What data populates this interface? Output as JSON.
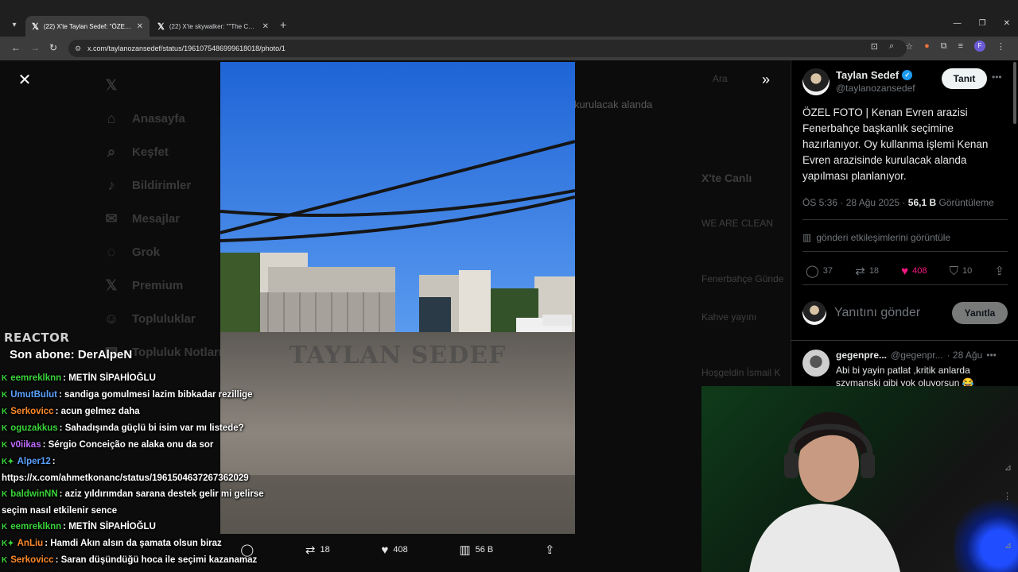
{
  "browser": {
    "tabs": [
      {
        "title": "(22) X'te Taylan Sedef: \"ÖZEL FO",
        "active": true
      },
      {
        "title": "(22) X'te skywalker: \"\"The Chos",
        "active": false
      }
    ],
    "new_tab": "+",
    "url": "x.com/taylanozansedef/status/1961075486999618018/photo/1"
  },
  "background": {
    "nav": [
      "Anasayfa",
      "Keşfet",
      "Bildirimler",
      "Mesajlar",
      "Grok",
      "Premium",
      "Topluluklar",
      "Topluluk Notları"
    ],
    "mid_text": "kurulacak alanda",
    "right_heading": "X'te Canlı",
    "right_lines": [
      "Ara",
      "WE ARE CLEAN",
      "Fenerbahçe Günde",
      "Kahve yayını",
      "Hoşgeldin İsmail K"
    ]
  },
  "photo": {
    "watermark": "TAYLAN SEDEF",
    "actions": {
      "retweets": "18",
      "likes": "408",
      "views": "56 B"
    }
  },
  "tweet": {
    "author_name": "Taylan Sedef",
    "author_handle": "@taylanozansedef",
    "follow_label": "Tanıt",
    "text": "ÖZEL FOTO | Kenan Evren arazisi Fenerbahçe başkanlık seçimine hazırlanıyor. Oy kullanma işlemi Kenan Evren arazisinde kurulacak alanda yapılması planlanıyor.",
    "time": "ÖS 5:36 · 28 Ağu 2025 ·",
    "views_count": "56,1 B",
    "views_label": "Görüntüleme",
    "engagements_link": "gönderi etkileşimlerini görüntüle",
    "stats": {
      "replies": "37",
      "retweets": "18",
      "likes": "408",
      "bookmarks": "10"
    },
    "reply_placeholder": "Yanıtını gönder",
    "reply_button": "Yanıtla"
  },
  "comment": {
    "name": "gegenpre...",
    "handle": "@gegenpr...",
    "date": "· 28 Ağu",
    "text": "Abi bi yayin patlat ,kritik anlarda szymanski gibi yok oluyorsun 😂"
  },
  "stream": {
    "logo": "REACTOR",
    "last_sub": "Son abone: DerAlpeN",
    "messages": [
      {
        "user": "eemreklknn",
        "color": "#3ad43a",
        "text": ": METİN SİPAHİOĞLU"
      },
      {
        "user": "UmutBulut",
        "color": "#5aa0ff",
        "text": ": sandiga gomulmesi lazim bibkadar rezillige"
      },
      {
        "user": "Serkovicc",
        "color": "#ff8a2a",
        "text": ": acun gelmez daha"
      },
      {
        "user": "oguzakkus",
        "color": "#3ad43a",
        "text": ": Sahadışında güçlü bi isim var mı listede?"
      },
      {
        "user": "v0iikas",
        "color": "#c06cff",
        "text": ": Sérgio Conceição ne alaka onu da sor"
      },
      {
        "user": "Alper12",
        "color": "#5aa0ff",
        "text": ": https://x.com/ahmetkonanc/status/1961504637267362029"
      },
      {
        "user": "baldwinNN",
        "color": "#3ad43a",
        "text": ": aziz yıldırımdan sarana destek gelir mi gelirse seçim nasıl etkilenir sence"
      },
      {
        "user": "eemreklknn",
        "color": "#3ad43a",
        "text": ": METİN SİPAHİOĞLU"
      },
      {
        "user": "AnLiu",
        "color": "#ff8a2a",
        "text": ": Hamdi Akın alsın da şamata olsun biraz"
      },
      {
        "user": "Serkovicc",
        "color": "#ff8a2a",
        "text": ": Saran düşündüğü hoca ile seçimi kazanamaz abi maalesef"
      }
    ]
  }
}
